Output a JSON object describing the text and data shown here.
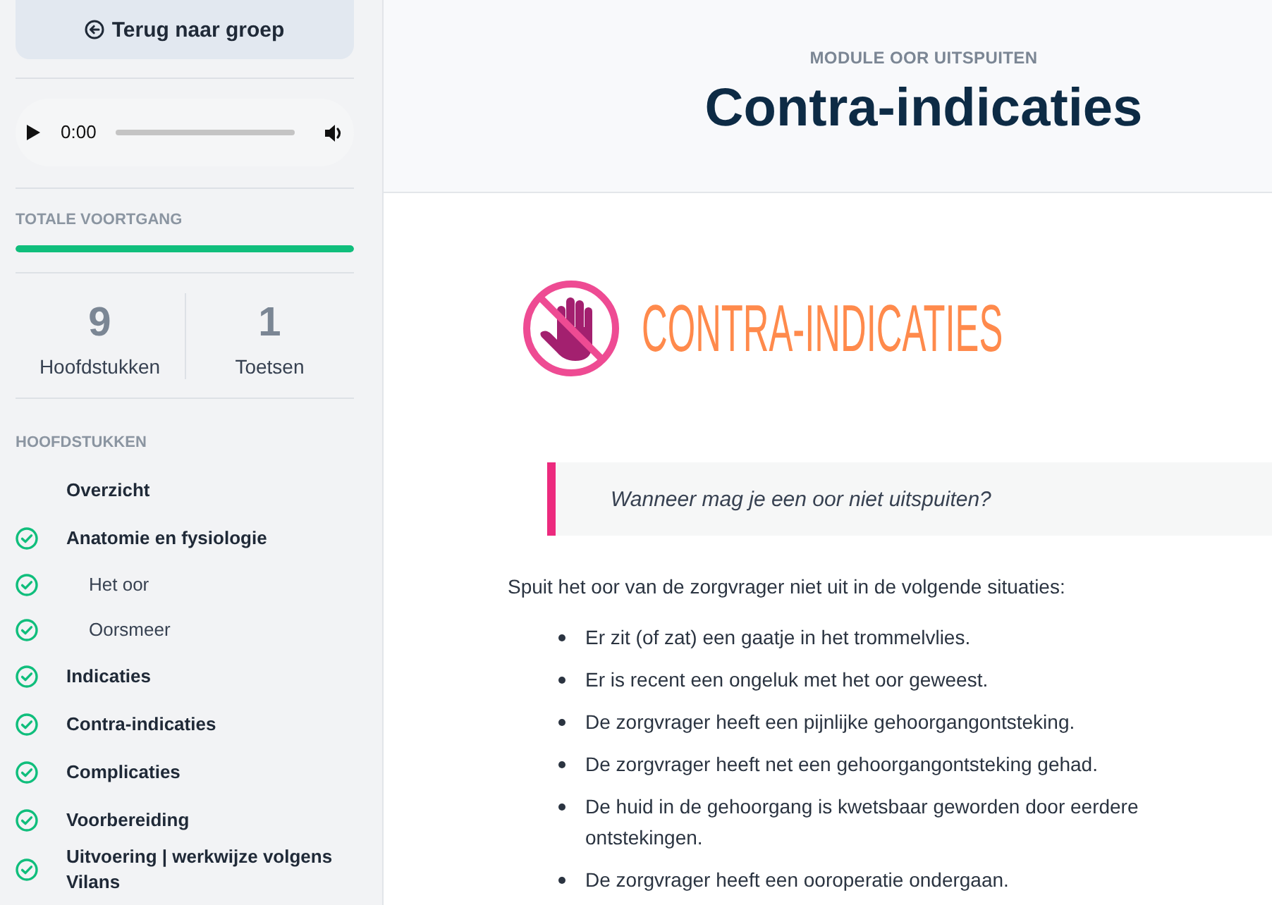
{
  "sidebar": {
    "back_button": {
      "label": "Terug naar groep"
    },
    "audio_player": {
      "time": "0:00"
    },
    "progress": {
      "label": "TOTALE VOORTGANG",
      "level": 1
    },
    "stats": [
      {
        "value": "9",
        "label": "Hoofdstukken"
      },
      {
        "value": "1",
        "label": "Toetsen"
      }
    ],
    "chapters": {
      "heading": "HOOFDSTUKKEN",
      "items": [
        {
          "label": "Overzicht",
          "done": false
        },
        {
          "label": "Anatomie en fysiologie",
          "done": true,
          "children": [
            {
              "label": "Het oor",
              "done": true
            },
            {
              "label": "Oorsmeer",
              "done": true
            }
          ]
        },
        {
          "label": "Indicaties",
          "done": true
        },
        {
          "label": "Contra-indicaties",
          "done": true
        },
        {
          "label": "Complicaties",
          "done": true
        },
        {
          "label": "Voorbereiding",
          "done": true
        },
        {
          "label": "Uitvoering | werkwijze volgens Vilans",
          "done": true
        }
      ]
    }
  },
  "page_header": {
    "module": "MODULE OOR UITSPUITEN",
    "title": "Contra-indicaties"
  },
  "content": {
    "banner": {
      "title": "CONTRA-INDICATIES"
    },
    "quote": "Wanneer mag je een oor niet uitspuiten?",
    "intro": "Spuit het oor van de zorgvrager niet uit in de volgende situaties:",
    "bullets": [
      "Er zit (of zat) een gaatje in het trommelvlies.",
      "Er is recent een ongeluk met het oor geweest.",
      "De zorgvrager heeft een pijnlijke gehoorgangontsteking.",
      "De zorgvrager heeft net een gehoorgangontsteking gehad.",
      "De huid in de gehoorgang is kwetsbaar geworden door eerdere ontstekingen.",
      "De zorgvrager heeft een ooroperatie ondergaan."
    ]
  }
}
